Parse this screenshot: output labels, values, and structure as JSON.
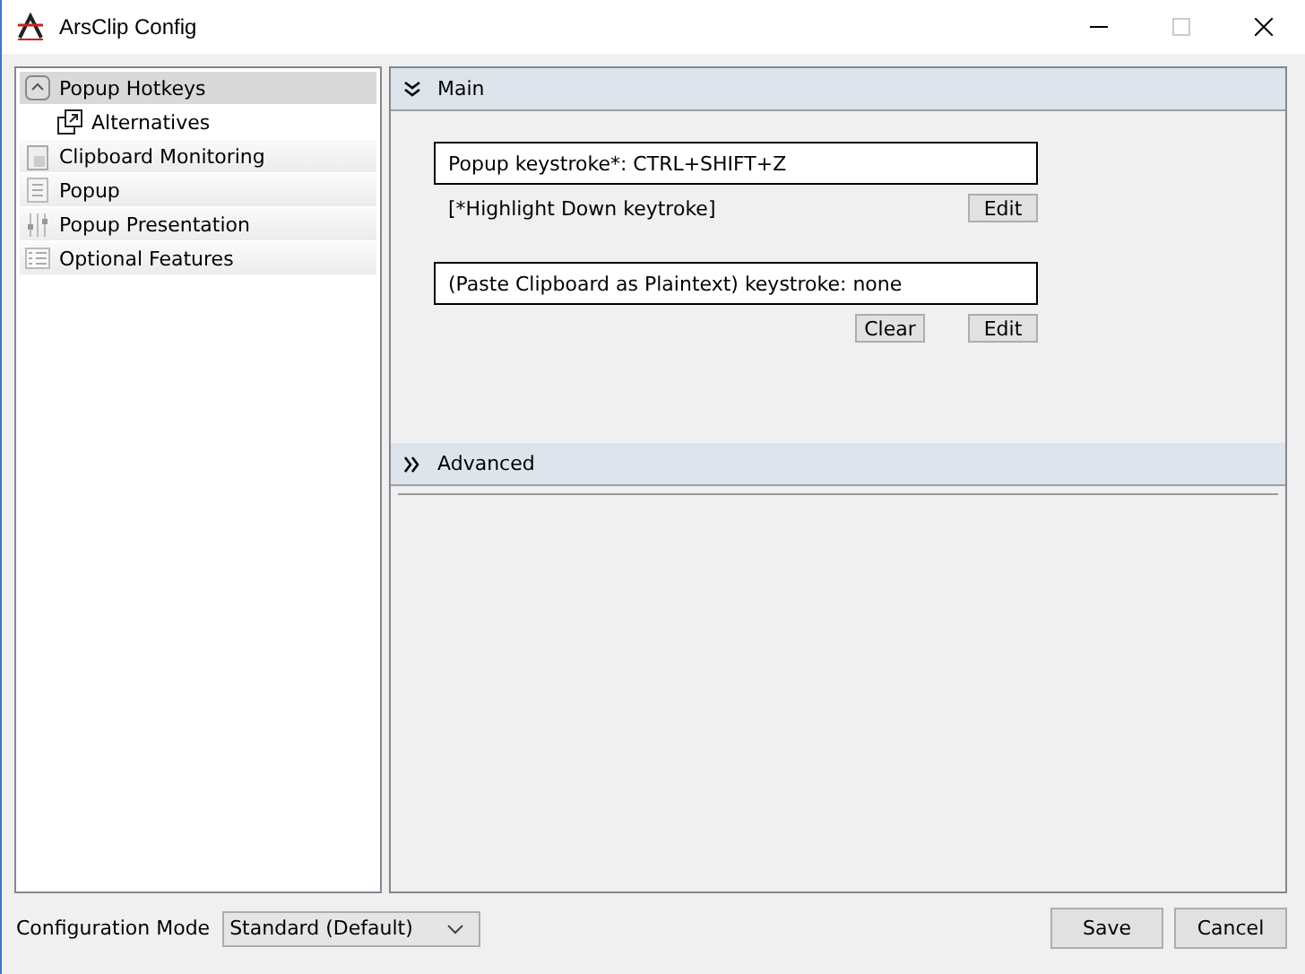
{
  "window": {
    "title": "ArsClip Config",
    "maximize_disabled": true
  },
  "sidebar": {
    "items": [
      {
        "label": "Popup Hotkeys",
        "selected": true,
        "children": [
          {
            "label": "Alternatives",
            "selected": false
          }
        ]
      },
      {
        "label": "Clipboard Monitoring",
        "selected": false
      },
      {
        "label": "Popup",
        "selected": false
      },
      {
        "label": "Popup Presentation",
        "selected": false
      },
      {
        "label": "Optional Features",
        "selected": false
      }
    ]
  },
  "sections": [
    {
      "title": "Main",
      "expanded": true,
      "groups": [
        {
          "field": "Popup keystroke*: CTRL+SHIFT+Z",
          "note": "[*Highlight Down keytroke]",
          "buttons": [
            "Edit"
          ]
        },
        {
          "field": "(Paste Clipboard as Plaintext) keystroke: none",
          "buttons": [
            "Clear",
            "Edit"
          ]
        }
      ]
    },
    {
      "title": "Advanced",
      "expanded": false
    }
  ],
  "footer": {
    "mode_label": "Configuration Mode",
    "mode_value": "Standard (Default)",
    "buttons": [
      "Save",
      "Cancel"
    ]
  }
}
